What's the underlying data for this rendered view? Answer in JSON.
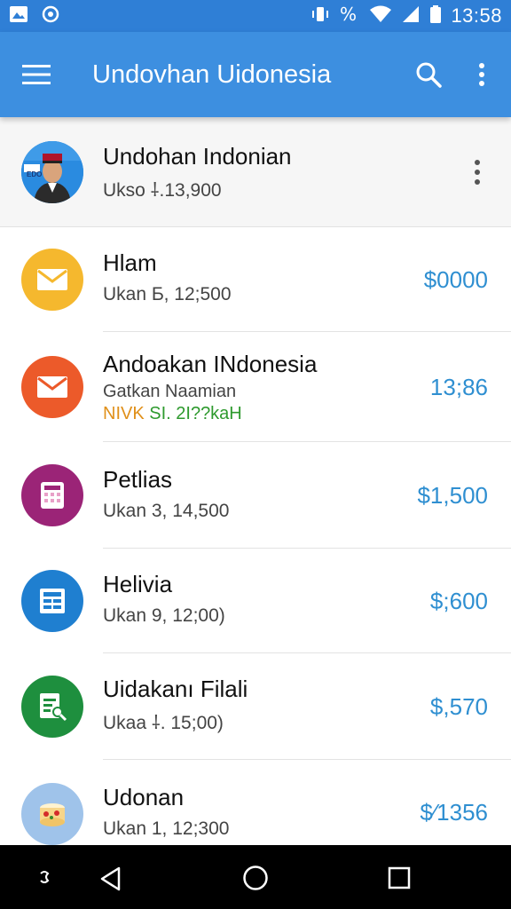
{
  "status_bar": {
    "time": "13:58"
  },
  "app_bar": {
    "title": "Undovhan Uidonesia"
  },
  "header_item": {
    "title": "Undohan Indonian",
    "subtitle": "Ukso  ⸸.13,900",
    "badge_text": "EDO"
  },
  "items": [
    {
      "title": "Hlam",
      "subtitle": "Ukan Ƃ, 12;500",
      "amount": "$0000",
      "icon": "mail-icon",
      "color": "#f5b82e"
    },
    {
      "title": "Andoakan INdonesia",
      "subtitle": "Gatkan Naamian",
      "extra_orange": "NIVK",
      "extra_green": "SI. 2I??kaH",
      "amount": "13;86",
      "icon": "mail-icon",
      "color": "#ec5a2a"
    },
    {
      "title": "Petlias",
      "subtitle": "Ukan 3, 14,500",
      "amount": "$1,500",
      "icon": "calculator-icon",
      "color": "#9b2477"
    },
    {
      "title": "Helivia",
      "subtitle": "Ukan 9, 12;00)",
      "amount": "$;600",
      "icon": "table-icon",
      "color": "#1f7fd0"
    },
    {
      "title": "Uidakanı Filali",
      "subtitle": "Ukaa  ⸸. 15;00)",
      "amount": "$,570",
      "icon": "document-search-icon",
      "color": "#1e8f3e"
    },
    {
      "title": "Udonan",
      "subtitle": "Ukan 1, 12;300",
      "amount": "$⁄1356",
      "icon": "cake-icon",
      "color": "#9fc3ea"
    }
  ]
}
